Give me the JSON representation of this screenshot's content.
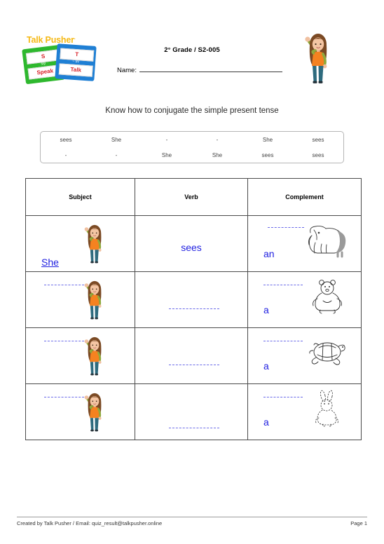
{
  "header": {
    "logo": {
      "brand": "Talk Pusher",
      "tm": ".",
      "green_card": {
        "top_letter": "S",
        "mid_text": "s/p",
        "bottom_label": "Speak"
      },
      "blue_card": {
        "top_letter": "T",
        "mid_text": "~ t/v",
        "bottom_label": "Talk"
      }
    },
    "grade": "2° Grade / S2-005",
    "name_label": "Name:",
    "girl_icon": "girl-waving-icon"
  },
  "title": "Know how to conjugate the simple present tense",
  "word_bank": {
    "rows": [
      [
        "sees",
        "She",
        "-",
        "-",
        "She",
        "sees"
      ],
      [
        "-",
        "-",
        "She",
        "She",
        "sees",
        "sees"
      ]
    ]
  },
  "main_table": {
    "columns": [
      "Subject",
      "Verb",
      "Complement"
    ],
    "rows": [
      {
        "subject_word": "She",
        "subject_blank": false,
        "verb_word": "sees",
        "verb_blank": false,
        "complement_article": "an",
        "complement_blank": true,
        "complement_picture": "elephant-icon"
      },
      {
        "subject_word": "",
        "subject_blank": true,
        "verb_word": "",
        "verb_blank": true,
        "complement_article": "a",
        "complement_blank": true,
        "complement_picture": "bear-icon"
      },
      {
        "subject_word": "",
        "subject_blank": true,
        "verb_word": "",
        "verb_blank": true,
        "complement_article": "a",
        "complement_blank": true,
        "complement_picture": "turtle-icon"
      },
      {
        "subject_word": "",
        "subject_blank": true,
        "verb_word": "",
        "verb_blank": true,
        "complement_article": "a",
        "complement_blank": true,
        "complement_picture": "rabbit-icon"
      }
    ]
  },
  "footer": {
    "left": "Created by Talk Pusher / Email: quiz_result@talkpusher.online",
    "right": "Page 1"
  },
  "colors": {
    "answer_blue": "#1f1fe0",
    "blank_blue": "#6a6ae8",
    "logo_yellow": "#f5b915",
    "card_green": "#2eb82e",
    "card_blue": "#1f7fd4"
  }
}
